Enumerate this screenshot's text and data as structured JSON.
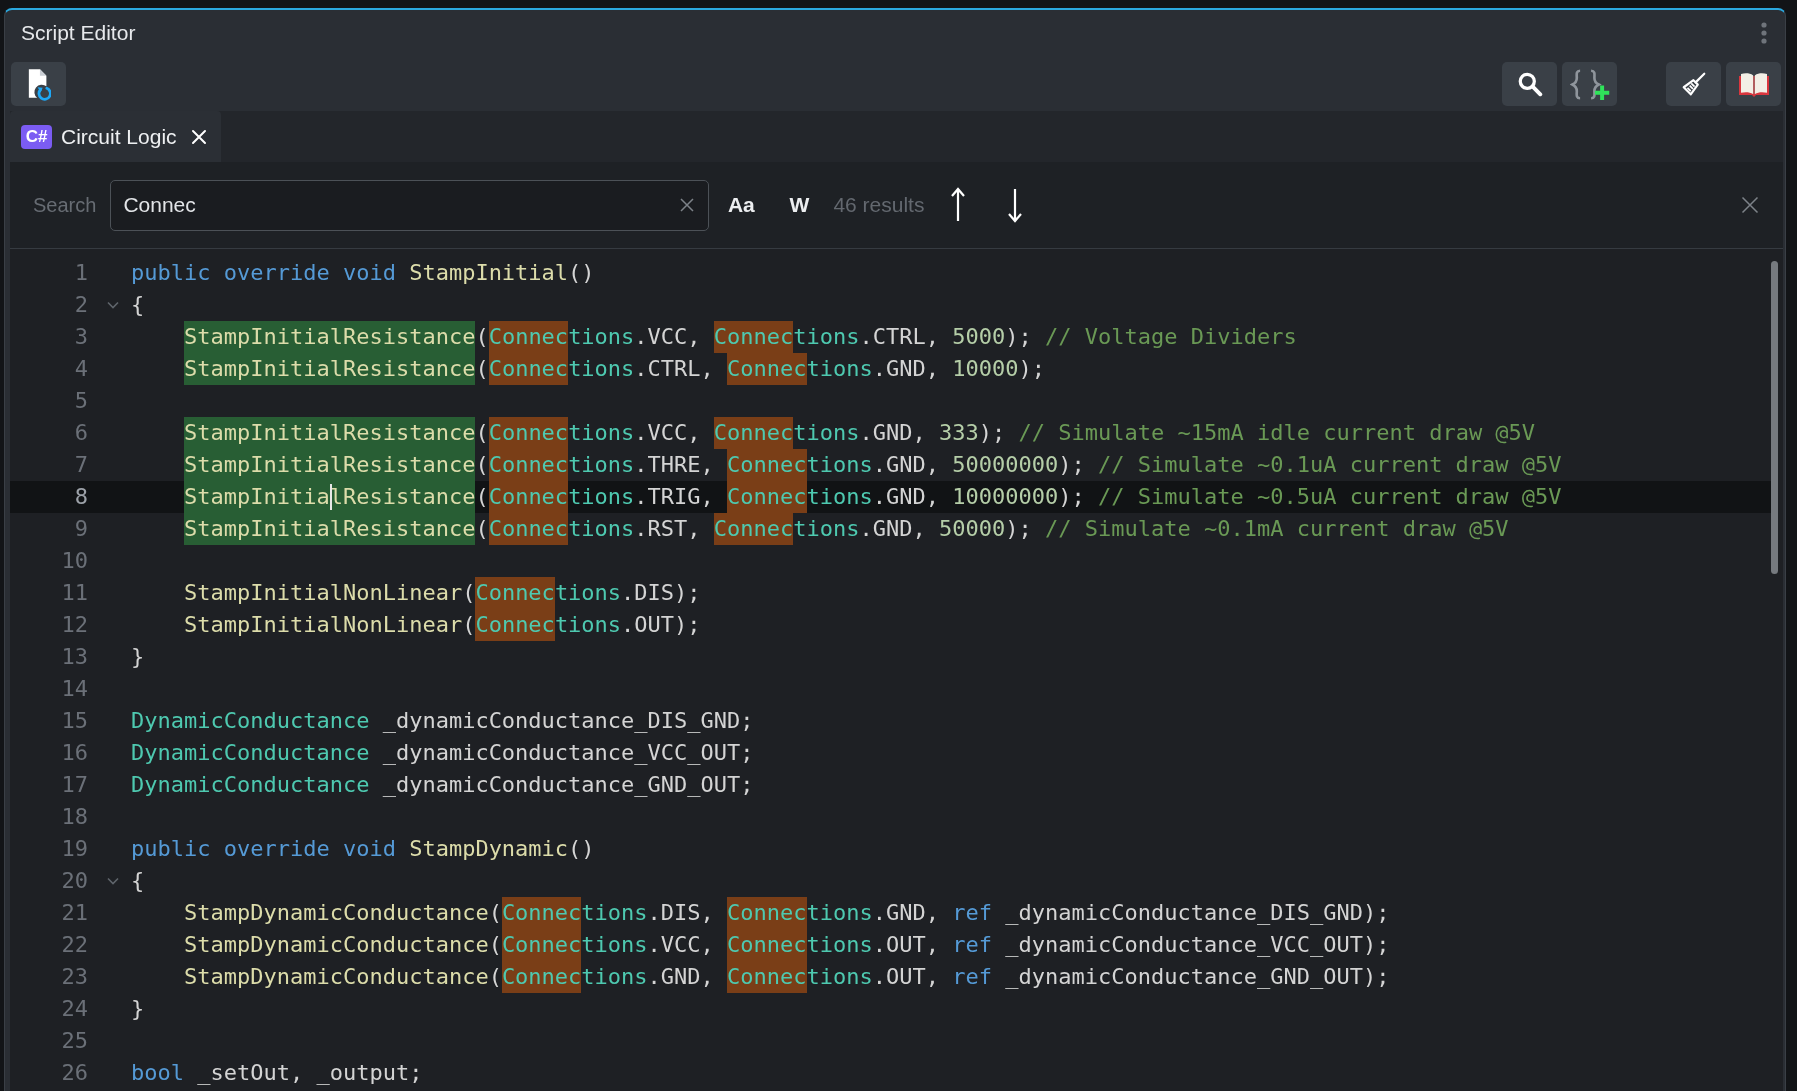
{
  "window": {
    "title": "Script Editor"
  },
  "tabs": [
    {
      "label": "Circuit Logic",
      "language_badge": "C#",
      "selected": true
    }
  ],
  "search": {
    "label": "Search",
    "value": "Connec",
    "match_case_toggle": "Aa",
    "whole_word_toggle": "W",
    "result_count": "46 results"
  },
  "editor": {
    "lines": [
      {
        "line_number": "1",
        "current": false,
        "tokens": [
          {
            "text": "public override void ",
            "kind": "keyword"
          },
          {
            "text": "StampInitial",
            "kind": "method"
          },
          {
            "text": "()",
            "kind": "plain"
          }
        ]
      },
      {
        "line_number": "2",
        "current": false,
        "fold_marker": {
          "expanded": true
        },
        "tokens": [
          {
            "text": "{",
            "kind": "plain"
          }
        ]
      },
      {
        "line_number": "3",
        "current": false,
        "tokens": [
          {
            "text": "    StampInitialResistance",
            "kind": "method",
            "occurrence_highlight": true
          },
          {
            "text": "(",
            "kind": "plain"
          },
          {
            "text": "Connec",
            "kind": "type",
            "search_match": true
          },
          {
            "text": "tions",
            "kind": "type"
          },
          {
            "text": ".VCC, ",
            "kind": "plain"
          },
          {
            "text": "Connec",
            "kind": "type",
            "search_match": true
          },
          {
            "text": "tions",
            "kind": "type"
          },
          {
            "text": ".CTRL, ",
            "kind": "plain"
          },
          {
            "text": "5000",
            "kind": "number"
          },
          {
            "text": "); ",
            "kind": "plain"
          },
          {
            "text": "// Voltage Dividers",
            "kind": "comment"
          }
        ]
      },
      {
        "line_number": "4",
        "current": false,
        "tokens": [
          {
            "text": "    StampInitialResistance",
            "kind": "method",
            "occurrence_highlight": true
          },
          {
            "text": "(",
            "kind": "plain"
          },
          {
            "text": "Connec",
            "kind": "type",
            "search_match": true
          },
          {
            "text": "tions",
            "kind": "type"
          },
          {
            "text": ".CTRL, ",
            "kind": "plain"
          },
          {
            "text": "Connec",
            "kind": "type",
            "search_match": true
          },
          {
            "text": "tions",
            "kind": "type"
          },
          {
            "text": ".GND, ",
            "kind": "plain"
          },
          {
            "text": "10000",
            "kind": "number"
          },
          {
            "text": ");",
            "kind": "plain"
          }
        ]
      },
      {
        "line_number": "5",
        "current": false
      },
      {
        "line_number": "6",
        "current": false,
        "tokens": [
          {
            "text": "    StampInitialResistance",
            "kind": "method",
            "occurrence_highlight": true
          },
          {
            "text": "(",
            "kind": "plain"
          },
          {
            "text": "Connec",
            "kind": "type",
            "search_match": true
          },
          {
            "text": "tions",
            "kind": "type"
          },
          {
            "text": ".VCC, ",
            "kind": "plain"
          },
          {
            "text": "Connec",
            "kind": "type",
            "search_match": true
          },
          {
            "text": "tions",
            "kind": "type"
          },
          {
            "text": ".GND, ",
            "kind": "plain"
          },
          {
            "text": "333",
            "kind": "number"
          },
          {
            "text": "); ",
            "kind": "plain"
          },
          {
            "text": "// Simulate ~15mA idle current draw @5V",
            "kind": "comment"
          }
        ]
      },
      {
        "line_number": "7",
        "current": false,
        "tokens": [
          {
            "text": "    StampInitialResistance",
            "kind": "method",
            "occurrence_highlight": true
          },
          {
            "text": "(",
            "kind": "plain"
          },
          {
            "text": "Connec",
            "kind": "type",
            "search_match": true
          },
          {
            "text": "tions",
            "kind": "type"
          },
          {
            "text": ".THRE, ",
            "kind": "plain"
          },
          {
            "text": "Connec",
            "kind": "type",
            "search_match": true
          },
          {
            "text": "tions",
            "kind": "type"
          },
          {
            "text": ".GND, ",
            "kind": "plain"
          },
          {
            "text": "50000000",
            "kind": "number"
          },
          {
            "text": "); ",
            "kind": "plain"
          },
          {
            "text": "// Simulate ~0.1uA current draw @5V",
            "kind": "comment"
          }
        ]
      },
      {
        "line_number": "8",
        "current": true,
        "tokens": [
          {
            "text": "    StampInitia",
            "kind": "method",
            "occurrence_highlight": true
          },
          {
            "kind": "cursor"
          },
          {
            "text": "lResistance",
            "kind": "method",
            "occurrence_highlight": true
          },
          {
            "text": "(",
            "kind": "plain"
          },
          {
            "text": "Connec",
            "kind": "type",
            "search_match": true
          },
          {
            "text": "tions",
            "kind": "type"
          },
          {
            "text": ".TRIG, ",
            "kind": "plain"
          },
          {
            "text": "Connec",
            "kind": "type",
            "search_match": true
          },
          {
            "text": "tions",
            "kind": "type"
          },
          {
            "text": ".GND, ",
            "kind": "plain"
          },
          {
            "text": "10000000",
            "kind": "number"
          },
          {
            "text": "); ",
            "kind": "plain"
          },
          {
            "text": "// Simulate ~0.5uA current draw @5V",
            "kind": "comment"
          }
        ]
      },
      {
        "line_number": "9",
        "current": false,
        "tokens": [
          {
            "text": "    StampInitialResistance",
            "kind": "method",
            "occurrence_highlight": true
          },
          {
            "text": "(",
            "kind": "plain"
          },
          {
            "text": "Connec",
            "kind": "type",
            "search_match": true
          },
          {
            "text": "tions",
            "kind": "type"
          },
          {
            "text": ".RST, ",
            "kind": "plain"
          },
          {
            "text": "Connec",
            "kind": "type",
            "search_match": true
          },
          {
            "text": "tions",
            "kind": "type"
          },
          {
            "text": ".GND, ",
            "kind": "plain"
          },
          {
            "text": "50000",
            "kind": "number"
          },
          {
            "text": "); ",
            "kind": "plain"
          },
          {
            "text": "// Simulate ~0.1mA current draw @5V",
            "kind": "comment"
          }
        ]
      },
      {
        "line_number": "10",
        "current": false
      },
      {
        "line_number": "11",
        "current": false,
        "tokens": [
          {
            "text": "    StampInitialNonLinear",
            "kind": "method"
          },
          {
            "text": "(",
            "kind": "plain"
          },
          {
            "text": "Connec",
            "kind": "type",
            "search_match": true
          },
          {
            "text": "tions",
            "kind": "type"
          },
          {
            "text": ".DIS);",
            "kind": "plain"
          }
        ]
      },
      {
        "line_number": "12",
        "current": false,
        "tokens": [
          {
            "text": "    StampInitialNonLinear",
            "kind": "method"
          },
          {
            "text": "(",
            "kind": "plain"
          },
          {
            "text": "Connec",
            "kind": "type",
            "search_match": true
          },
          {
            "text": "tions",
            "kind": "type"
          },
          {
            "text": ".OUT);",
            "kind": "plain"
          }
        ]
      },
      {
        "line_number": "13",
        "current": false,
        "tokens": [
          {
            "text": "}",
            "kind": "plain"
          }
        ]
      },
      {
        "line_number": "14",
        "current": false
      },
      {
        "line_number": "15",
        "current": false,
        "tokens": [
          {
            "text": "DynamicConductance",
            "kind": "type"
          },
          {
            "text": " _dynamicConductance_DIS_GND;",
            "kind": "plain"
          }
        ]
      },
      {
        "line_number": "16",
        "current": false,
        "tokens": [
          {
            "text": "DynamicConductance",
            "kind": "type"
          },
          {
            "text": " _dynamicConductance_VCC_OUT;",
            "kind": "plain"
          }
        ]
      },
      {
        "line_number": "17",
        "current": false,
        "tokens": [
          {
            "text": "DynamicConductance",
            "kind": "type"
          },
          {
            "text": " _dynamicConductance_GND_OUT;",
            "kind": "plain"
          }
        ]
      },
      {
        "line_number": "18",
        "current": false
      },
      {
        "line_number": "19",
        "current": false,
        "tokens": [
          {
            "text": "public override void ",
            "kind": "keyword"
          },
          {
            "text": "StampDynamic",
            "kind": "method"
          },
          {
            "text": "()",
            "kind": "plain"
          }
        ]
      },
      {
        "line_number": "20",
        "current": false,
        "fold_marker": {
          "expanded": true
        },
        "tokens": [
          {
            "text": "{",
            "kind": "plain"
          }
        ]
      },
      {
        "line_number": "21",
        "current": false,
        "tokens": [
          {
            "text": "    StampDynamicConductance",
            "kind": "method"
          },
          {
            "text": "(",
            "kind": "plain"
          },
          {
            "text": "Connec",
            "kind": "type",
            "search_match": true
          },
          {
            "text": "tions",
            "kind": "type"
          },
          {
            "text": ".DIS, ",
            "kind": "plain"
          },
          {
            "text": "Connec",
            "kind": "type",
            "search_match": true
          },
          {
            "text": "tions",
            "kind": "type"
          },
          {
            "text": ".GND, ",
            "kind": "plain"
          },
          {
            "text": "ref",
            "kind": "keyword"
          },
          {
            "text": " _dynamicConductance_DIS_GND);",
            "kind": "plain"
          }
        ]
      },
      {
        "line_number": "22",
        "current": false,
        "tokens": [
          {
            "text": "    StampDynamicConductance",
            "kind": "method"
          },
          {
            "text": "(",
            "kind": "plain"
          },
          {
            "text": "Connec",
            "kind": "type",
            "search_match": true
          },
          {
            "text": "tions",
            "kind": "type"
          },
          {
            "text": ".VCC, ",
            "kind": "plain"
          },
          {
            "text": "Connec",
            "kind": "type",
            "search_match": true
          },
          {
            "text": "tions",
            "kind": "type"
          },
          {
            "text": ".OUT, ",
            "kind": "plain"
          },
          {
            "text": "ref",
            "kind": "keyword"
          },
          {
            "text": " _dynamicConductance_VCC_OUT);",
            "kind": "plain"
          }
        ]
      },
      {
        "line_number": "23",
        "current": false,
        "tokens": [
          {
            "text": "    StampDynamicConductance",
            "kind": "method"
          },
          {
            "text": "(",
            "kind": "plain"
          },
          {
            "text": "Connec",
            "kind": "type",
            "search_match": true
          },
          {
            "text": "tions",
            "kind": "type"
          },
          {
            "text": ".GND, ",
            "kind": "plain"
          },
          {
            "text": "Connec",
            "kind": "type",
            "search_match": true
          },
          {
            "text": "tions",
            "kind": "type"
          },
          {
            "text": ".OUT, ",
            "kind": "plain"
          },
          {
            "text": "ref",
            "kind": "keyword"
          },
          {
            "text": " _dynamicConductance_GND_OUT);",
            "kind": "plain"
          }
        ]
      },
      {
        "line_number": "24",
        "current": false,
        "tokens": [
          {
            "text": "}",
            "kind": "plain"
          }
        ]
      },
      {
        "line_number": "25",
        "current": false
      },
      {
        "line_number": "26",
        "current": false,
        "tokens": [
          {
            "text": "bool",
            "kind": "keyword"
          },
          {
            "text": " _setOut, _output;",
            "kind": "plain"
          }
        ]
      }
    ]
  }
}
